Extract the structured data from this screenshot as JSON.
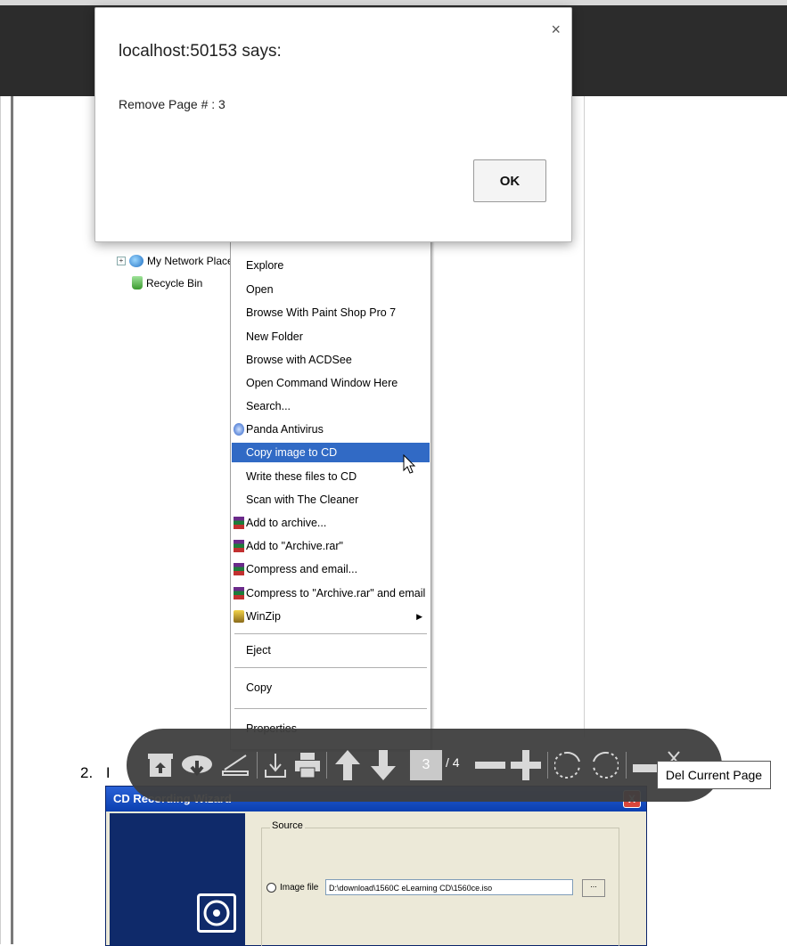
{
  "dialog": {
    "title": "localhost:50153 says:",
    "message": "Remove Page # : 3",
    "ok_label": "OK",
    "close_glyph": "×"
  },
  "tree": {
    "network_label": "My Network Place",
    "recycle_label": "Recycle Bin",
    "expander": "+"
  },
  "context_menu": {
    "items": [
      "Explore",
      "Open",
      "Browse With Paint Shop Pro 7",
      "New Folder",
      "Browse with ACDSee",
      "Open Command Window Here",
      "Search...",
      "Panda Antivirus",
      "Copy image to CD",
      "Write these files to CD",
      "Scan with The Cleaner",
      "Add to archive...",
      "Add to \"Archive.rar\"",
      "Compress and email...",
      "Compress to \"Archive.rar\" and email",
      "WinZip",
      "Eject",
      "Copy",
      "Properties"
    ],
    "highlighted": "Copy image to CD"
  },
  "toolbar": {
    "current_page": "3",
    "total_pages": "/ 4",
    "tooltip": "Del Current Page",
    "icons": [
      "archive-icon",
      "cloud-download-icon",
      "scanner-icon",
      "download-icon",
      "print-icon",
      "arrow-up-icon",
      "arrow-down-icon",
      "zoom-out-icon",
      "zoom-in-icon",
      "rotate-left-icon",
      "rotate-right-icon",
      "delete-page-icon"
    ]
  },
  "doc": {
    "step_number": "2.",
    "step_text": "I"
  },
  "wizard": {
    "title": "CD Recording Wizard",
    "close_glyph": "X",
    "source_label": "Source",
    "image_file_label": "Image file",
    "image_file_value": "D:\\download\\1560C eLearning CD\\1560ce.iso",
    "browse_label": "..."
  }
}
